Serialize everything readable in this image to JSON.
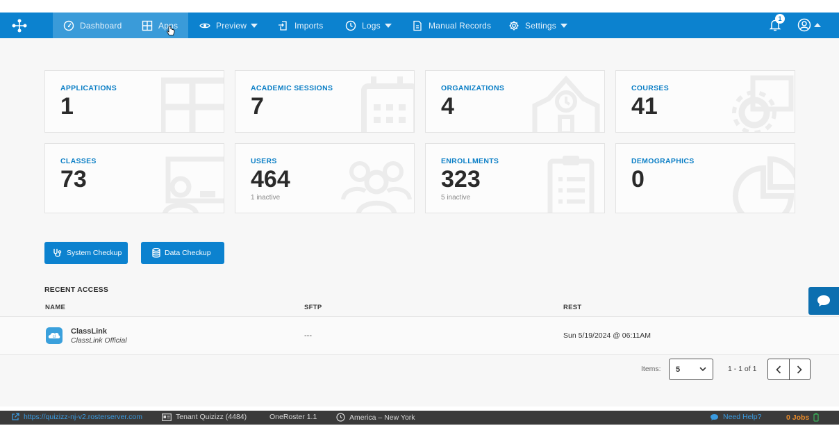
{
  "nav": {
    "items": [
      {
        "label": "Dashboard",
        "icon": "dashboard-icon"
      },
      {
        "label": "Apps",
        "icon": "apps-grid-icon"
      },
      {
        "label": "Preview",
        "icon": "eye-icon"
      },
      {
        "label": "Imports",
        "icon": "import-icon"
      },
      {
        "label": "Logs",
        "icon": "clock-icon"
      },
      {
        "label": "Manual Records",
        "icon": "file-icon"
      },
      {
        "label": "Settings",
        "icon": "gear-icon"
      }
    ],
    "notification_count": "1"
  },
  "stats": [
    {
      "label": "APPLICATIONS",
      "value": "1",
      "sub": ""
    },
    {
      "label": "ACADEMIC SESSIONS",
      "value": "7",
      "sub": ""
    },
    {
      "label": "ORGANIZATIONS",
      "value": "4",
      "sub": ""
    },
    {
      "label": "COURSES",
      "value": "41",
      "sub": ""
    },
    {
      "label": "CLASSES",
      "value": "73",
      "sub": ""
    },
    {
      "label": "USERS",
      "value": "464",
      "sub": "1 inactive"
    },
    {
      "label": "ENROLLMENTS",
      "value": "323",
      "sub": "5 inactive"
    },
    {
      "label": "DEMOGRAPHICS",
      "value": "0",
      "sub": ""
    }
  ],
  "buttons": {
    "system_checkup": "System Checkup",
    "data_checkup": "Data Checkup"
  },
  "recent": {
    "title": "RECENT ACCESS",
    "headers": [
      "NAME",
      "SFTP",
      "REST"
    ],
    "rows": [
      {
        "name": "ClassLink",
        "sub": "ClassLink Official",
        "sftp": "---",
        "rest": "Sun 5/19/2024 @ 06:11AM"
      }
    ]
  },
  "pagination": {
    "items_label": "Items:",
    "items_value": "5",
    "range": "1 - 1 of 1"
  },
  "status_bar": {
    "url": "https://quizizz-nj-v2.rosterserver.com",
    "tenant": "Tenant Quizizz (4484)",
    "version": "OneRoster 1.1",
    "timezone": "America – New York",
    "help": "Need Help?",
    "jobs": "0 Jobs"
  },
  "colors": {
    "primary": "#0c82cf",
    "accent_label": "#0c7fc6",
    "status_bar": "#3a3a3a",
    "jobs": "#e98b2a"
  }
}
